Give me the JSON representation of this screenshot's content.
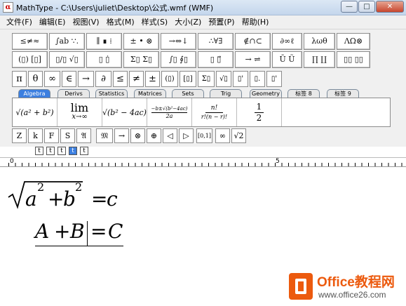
{
  "window": {
    "title": "MathType - C:\\Users\\juliet\\Desktop\\公式.wmf (WMF)",
    "icon_glyph": "α",
    "minimize_label": "—",
    "maximize_label": "□",
    "close_label": "✕"
  },
  "menu": [
    "文件(F)",
    "编辑(E)",
    "视图(V)",
    "格式(M)",
    "样式(S)",
    "大小(Z)",
    "预置(P)",
    "帮助(H)"
  ],
  "palette_row1": [
    "≤≠≈",
    "∫ab ∵.",
    "∥ ∎ ⁞",
    "± • ⊗",
    "→⇔↓",
    "∴∀∃",
    "∉∩⊂",
    "∂∞ℓ",
    "λωθ",
    "ΛΩ⊗"
  ],
  "palette_row2": [
    "(▯) [▯]",
    "▯/▯ √▯",
    "▯ ▯̇",
    "Σ▯ Σ▯",
    "∫▯ ∮▯",
    "▯ ▯⃗",
    "→ ⇌",
    "Ū Ũ",
    "∏ ∐",
    "▯▯ ▯▯"
  ],
  "symbol_row": [
    "π",
    "θ",
    "∞",
    "∈",
    "→",
    "∂",
    "≤",
    "≠",
    "±",
    "(▯)",
    "[▯]",
    "Σ▯",
    "√▯",
    "▯'",
    "▯.",
    "▯'"
  ],
  "tabs": [
    "Algebra",
    "Derivs",
    "Statistics",
    "Matrices",
    "Sets",
    "Trig",
    "Geometry",
    "标签 8",
    "标签 9"
  ],
  "templates": {
    "t1": "√(a² + b²)",
    "t2_top": "lim",
    "t2_bottom": "x→∞",
    "t3": "√(b² − 4ac)",
    "t4_top": "−b±√(b²−4ac)",
    "t4_bottom": "2a",
    "t5_top": "n!",
    "t5_bottom": "r!(n − r)!",
    "t6_top": "1",
    "t6_bottom": "2"
  },
  "small_row": [
    "Z",
    "k",
    "F",
    "S",
    "𝔄",
    "𝔐",
    "→",
    "⊗",
    "⊕",
    "◁",
    "▷",
    "[0,1]",
    "∞",
    "√2"
  ],
  "size_buttons": [
    "t",
    "t",
    "t",
    "t",
    "t"
  ],
  "ruler": {
    "mark0": "0",
    "mark5": "5"
  },
  "document": {
    "eq1_a": "a",
    "eq1_exp1": "2",
    "eq1_plus": "+",
    "eq1_b": "b",
    "eq1_exp2": "2",
    "eq1_eq": "=",
    "eq1_c": "c",
    "eq2_A": "A",
    "eq2_plus": "+",
    "eq2_B": "B",
    "eq2_eq": "=",
    "eq2_C": "C"
  },
  "watermark": {
    "title": "Office教程网",
    "url": "www.office26.com"
  }
}
